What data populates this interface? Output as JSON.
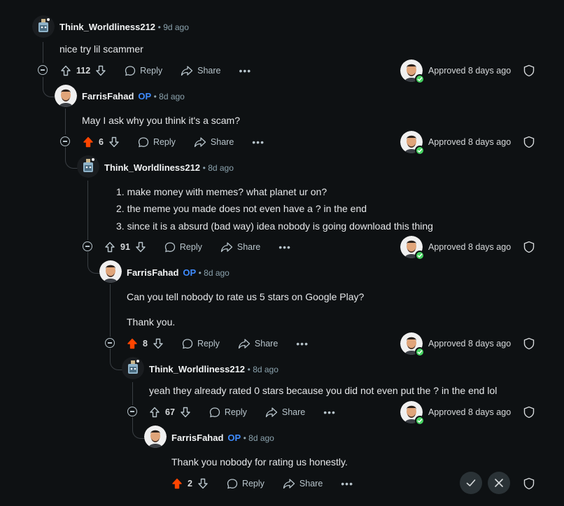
{
  "comments": [
    {
      "username": "Think_Worldliness212",
      "op": "",
      "time": "• 9d ago",
      "lines": [
        "nice try lil scammer"
      ],
      "score": "112",
      "upvoted": false,
      "reply": "Reply",
      "share": "Share",
      "approved": "Approved 8 days ago"
    },
    {
      "username": "FarrisFahad",
      "op": "OP",
      "time": "• 8d ago",
      "lines": [
        "May I ask why you think it's a scam?"
      ],
      "score": "6",
      "upvoted": true,
      "reply": "Reply",
      "share": "Share",
      "approved": "Approved 8 days ago"
    },
    {
      "username": "Think_Worldliness212",
      "op": "",
      "time": "• 8d ago",
      "lines": [
        "1. make money with memes? what planet ur on?",
        "2. the meme you made does not even have a ? in the end",
        "3. since it is a absurd (bad way) idea nobody is going download this thing"
      ],
      "score": "91",
      "upvoted": false,
      "reply": "Reply",
      "share": "Share",
      "approved": "Approved 8 days ago"
    },
    {
      "username": "FarrisFahad",
      "op": "OP",
      "time": "• 8d ago",
      "lines": [
        "Can you tell nobody to rate us 5 stars on Google Play?",
        "Thank you."
      ],
      "score": "8",
      "upvoted": true,
      "reply": "Reply",
      "share": "Share",
      "approved": "Approved 8 days ago"
    },
    {
      "username": "Think_Worldliness212",
      "op": "",
      "time": "• 8d ago",
      "lines": [
        "yeah they already rated 0 stars because you did not even put the ? in the end lol"
      ],
      "score": "67",
      "upvoted": false,
      "reply": "Reply",
      "share": "Share",
      "approved": "Approved 8 days ago"
    },
    {
      "username": "FarrisFahad",
      "op": "OP",
      "time": "• 8d ago",
      "lines": [
        "Thank you nobody for rating us honestly."
      ],
      "score": "2",
      "upvoted": true,
      "reply": "Reply",
      "share": "Share",
      "approved": ""
    }
  ],
  "more_label": "•••",
  "colors": {
    "background": "#0e1113",
    "upvote": "#ff4500",
    "op": "#3f8cff",
    "approved_check": "#46d160"
  },
  "icons": [
    "collapse-icon",
    "upvote-icon",
    "downvote-icon",
    "reply-icon",
    "share-icon",
    "more-icon",
    "shield-icon",
    "approve-icon",
    "remove-icon"
  ]
}
